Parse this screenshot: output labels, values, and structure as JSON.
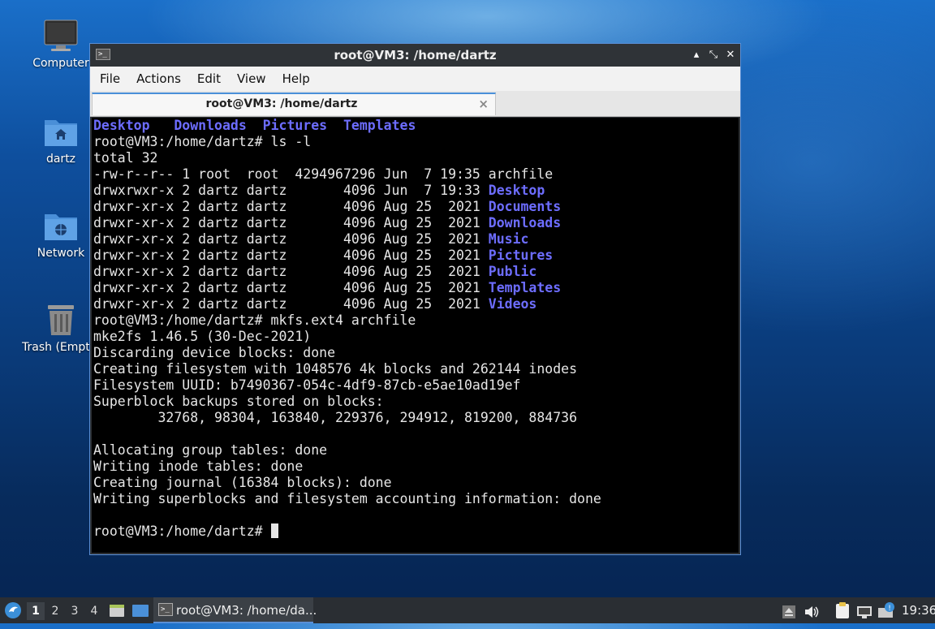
{
  "desktop": {
    "icons": [
      {
        "label": "Computer",
        "icon": "monitor-icon"
      },
      {
        "label": "dartz",
        "icon": "home-folder-icon"
      },
      {
        "label": "Network",
        "icon": "network-folder-icon"
      },
      {
        "label": "Trash (Empty)",
        "icon": "trash-icon"
      }
    ]
  },
  "window": {
    "title": "root@VM3: /home/dartz",
    "menu": [
      "File",
      "Actions",
      "Edit",
      "View",
      "Help"
    ],
    "tab_title": "root@VM3: /home/dartz",
    "tab_close": "×",
    "buttons": {
      "minimize": "▴",
      "maximize": "⤡",
      "close": "✕"
    }
  },
  "terminal": {
    "lines": [
      "§Desktop§   §Downloads§  §Pictures§  §Templates§",
      "root@VM3:/home/dartz# ls -l",
      "total 32",
      "-rw-r--r-- 1 root  root  4294967296 Jun  7 19:35 archfile",
      "drwxrwxr-x 2 dartz dartz       4096 Jun  7 19:33 §Desktop§",
      "drwxr-xr-x 2 dartz dartz       4096 Aug 25  2021 §Documents§",
      "drwxr-xr-x 2 dartz dartz       4096 Aug 25  2021 §Downloads§",
      "drwxr-xr-x 2 dartz dartz       4096 Aug 25  2021 §Music§",
      "drwxr-xr-x 2 dartz dartz       4096 Aug 25  2021 §Pictures§",
      "drwxr-xr-x 2 dartz dartz       4096 Aug 25  2021 §Public§",
      "drwxr-xr-x 2 dartz dartz       4096 Aug 25  2021 §Templates§",
      "drwxr-xr-x 2 dartz dartz       4096 Aug 25  2021 §Videos§",
      "root@VM3:/home/dartz# mkfs.ext4 archfile",
      "mke2fs 1.46.5 (30-Dec-2021)",
      "Discarding device blocks: done",
      "Creating filesystem with 1048576 4k blocks and 262144 inodes",
      "Filesystem UUID: b7490367-054c-4df9-87cb-e5ae10ad19ef",
      "Superblock backups stored on blocks:",
      "        32768, 98304, 163840, 229376, 294912, 819200, 884736",
      "",
      "Allocating group tables: done",
      "Writing inode tables: done",
      "Creating journal (16384 blocks): done",
      "Writing superblocks and filesystem accounting information: done",
      ""
    ],
    "prompt": "root@VM3:/home/dartz# ",
    "link_color": "#6d6dff"
  },
  "taskbar": {
    "workspaces": [
      "1",
      "2",
      "3",
      "4"
    ],
    "active_workspace": "1",
    "task_label": "root@VM3: /home/da...",
    "clock": "19:36",
    "tray_icons": [
      "eject-icon",
      "volume-icon",
      "clipboard-icon",
      "network-icon",
      "notification-icon"
    ]
  }
}
